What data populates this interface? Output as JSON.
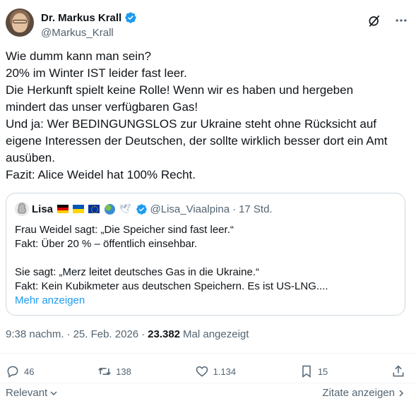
{
  "author": {
    "name": "Dr. Markus Krall",
    "handle": "@Markus_Krall",
    "verified_color": "#1d9bf0"
  },
  "top_icons": [
    "grok-icon",
    "more-icon"
  ],
  "tweet": {
    "lines": [
      "Wie dumm kann man sein?",
      "20% im Winter IST leider fast leer.",
      "Die Herkunft spielt keine Rolle! Wenn wir es haben und hergeben",
      "mindert das unser verfügbaren Gas!",
      "Und ja: Wer BEDINGUNGSLOS zur Ukraine steht ohne Rücksicht auf",
      "eigene Interessen der Deutschen, der sollte wirklich besser dort ein Amt",
      "ausüben.",
      "Fazit: Alice Weidel hat 100% Recht."
    ]
  },
  "quote": {
    "name": "Lisa",
    "handle": "@Lisa_Viaalpina",
    "separator": "·",
    "time": "17 Std.",
    "lines": [
      "Frau Weidel sagt: „Die Speicher sind fast leer.“",
      "Fakt: Über 20 % – öffentlich einsehbar.",
      "",
      "Sie sagt: „Merz leitet deutsches Gas in die Ukraine.“",
      "Fakt: Kein Kubikmeter aus deutschen Speichern. Es ist US-LNG...."
    ],
    "more_label": "Mehr anzeigen"
  },
  "meta": {
    "time": "9:38 nachm.",
    "dot1": "·",
    "date": "25. Feb. 2026",
    "dot2": "·",
    "views": "23.382",
    "views_label": "Mal angezeigt"
  },
  "actions": {
    "replies": "46",
    "reposts": "138",
    "likes": "1.134",
    "bookmarks": "15"
  },
  "footer": {
    "sort_label": "Relevant",
    "quotes_label": "Zitate anzeigen"
  }
}
